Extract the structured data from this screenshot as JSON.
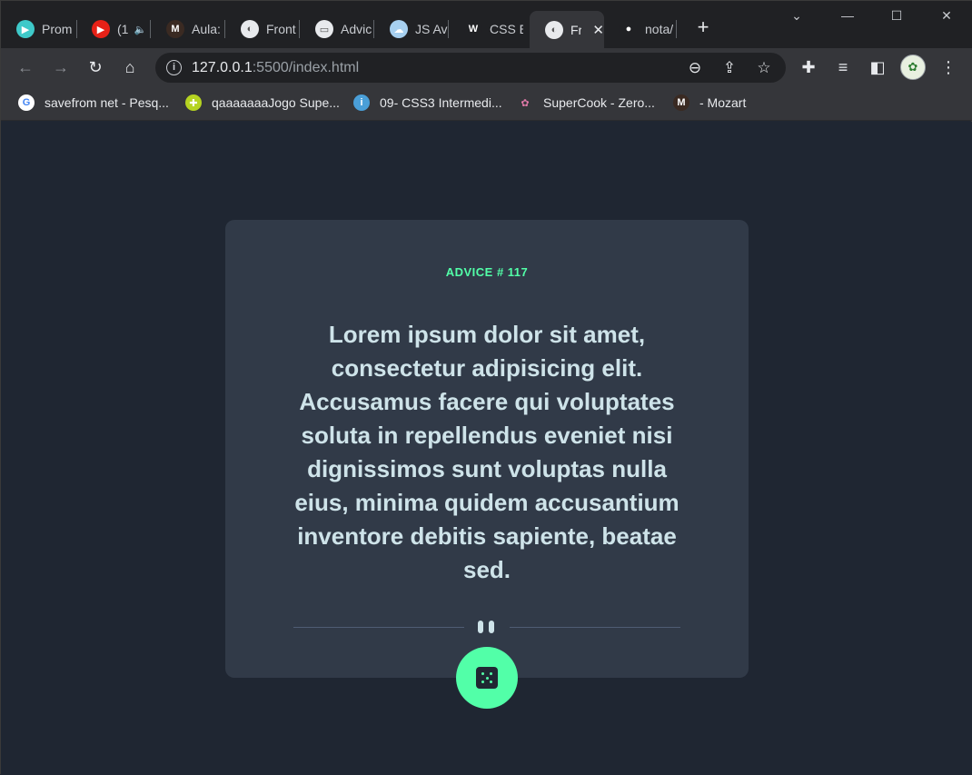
{
  "browser": {
    "tabs": [
      {
        "title": "Prom",
        "fav_color": "#3ec9c9",
        "fav_glyph": "▶"
      },
      {
        "title": "(1",
        "fav_color": "#e62117",
        "fav_glyph": "▶",
        "audio_icon": "speaker-icon"
      },
      {
        "title": "Aula:",
        "fav_color": "#3a2a22",
        "fav_glyph": "M"
      },
      {
        "title": "Front",
        "fav_color": "#e8eaed",
        "fav_glyph": "◐"
      },
      {
        "title": "Advic",
        "fav_color": "#e8eaed",
        "fav_glyph": "▭"
      },
      {
        "title": "JS Av",
        "fav_color": "#a7d0f0",
        "fav_glyph": "☁"
      },
      {
        "title": "CSS E",
        "fav_color": "#202124",
        "fav_glyph": "W"
      },
      {
        "title": "Fr",
        "fav_color": "#e8eaed",
        "fav_glyph": "◐",
        "active": true
      },
      {
        "title": "nota/",
        "fav_color": "#202124",
        "fav_glyph": "●"
      }
    ],
    "new_tab_label": "+",
    "address": {
      "host": "127.0.0.1",
      "rest": ":5500/index.html"
    },
    "bookmarks": [
      {
        "label": "savefrom net - Pesq...",
        "icon": "google-icon",
        "color": "#ffffff",
        "glyph": "G"
      },
      {
        "label": "qaaaaaaaJogo Supe...",
        "icon": "game-icon",
        "color": "#b5d321",
        "glyph": "✚"
      },
      {
        "label": "09- CSS3 Intermedi...",
        "icon": "info-icon",
        "color": "#4a9fd8",
        "glyph": "i"
      },
      {
        "label": "SuperCook - Zero...",
        "icon": "plant-icon",
        "color": "#35363a",
        "glyph": "✿"
      },
      {
        "label": "- Mozart",
        "icon": "mozart-icon",
        "color": "#3a2a22",
        "glyph": "M"
      }
    ]
  },
  "advice": {
    "id_label": "ADVICE # 117",
    "quote": "Lorem ipsum dolor sit amet, consectetur adipisicing elit. Accusamus facere qui voluptates soluta in repellendus eveniet nisi dignissimos sunt voluptas nulla eius, minima quidem accusantium inventore debitis sapiente, beatae sed."
  },
  "colors": {
    "accent": "#52ffa8",
    "card_bg": "#313a48",
    "page_bg": "#1f2632",
    "quote_text": "#cee3e9"
  }
}
